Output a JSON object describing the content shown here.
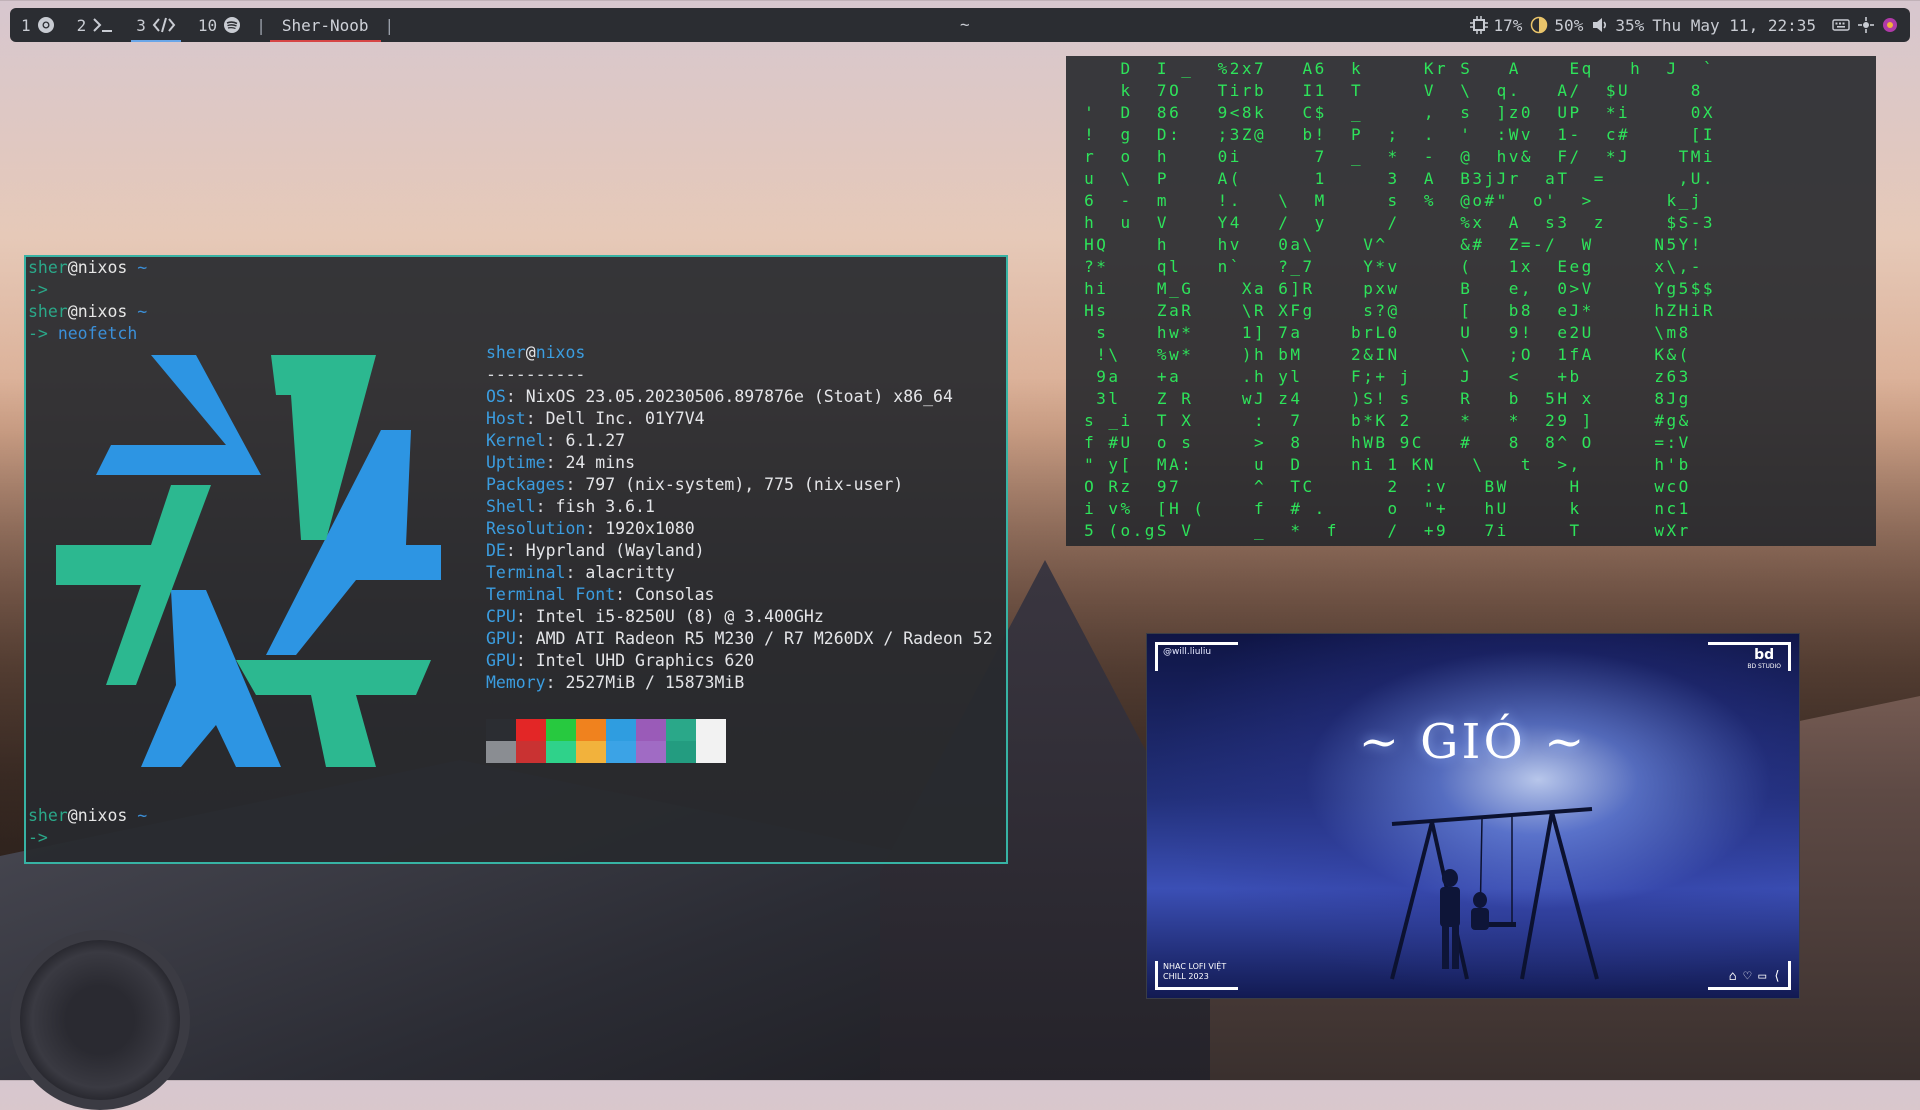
{
  "topbar": {
    "workspaces": [
      {
        "num": "1",
        "icon": "chromium-icon"
      },
      {
        "num": "2",
        "icon": "terminal-icon"
      },
      {
        "num": "3",
        "icon": "code-icon"
      },
      {
        "num": "10",
        "icon": "spotify-icon"
      }
    ],
    "window_title": "Sher-Noob",
    "center": "~",
    "cpu": "17%",
    "brightness": "50%",
    "volume": "35%",
    "datetime": "Thu May 11, 22:35"
  },
  "terminal": {
    "user": "sher",
    "at": "@",
    "host": "nixos",
    "tilde": "~",
    "arrow": "->",
    "command": "neofetch",
    "separator": "----------",
    "info": [
      {
        "k": "OS",
        "v": "NixOS 23.05.20230506.897876e (Stoat) x86_64"
      },
      {
        "k": "Host",
        "v": "Dell Inc. 01Y7V4"
      },
      {
        "k": "Kernel",
        "v": "6.1.27"
      },
      {
        "k": "Uptime",
        "v": "24 mins"
      },
      {
        "k": "Packages",
        "v": "797 (nix-system), 775 (nix-user)"
      },
      {
        "k": "Shell",
        "v": "fish 3.6.1"
      },
      {
        "k": "Resolution",
        "v": "1920x1080"
      },
      {
        "k": "DE",
        "v": "Hyprland (Wayland)"
      },
      {
        "k": "Terminal",
        "v": "alacritty"
      },
      {
        "k": "Terminal Font",
        "v": "Consolas"
      },
      {
        "k": "CPU",
        "v": "Intel i5-8250U (8) @ 3.400GHz"
      },
      {
        "k": "GPU",
        "v": "AMD ATI Radeon R5 M230 / R7 M260DX / Radeon 52"
      },
      {
        "k": "GPU",
        "v": "Intel UHD Graphics 620"
      },
      {
        "k": "Memory",
        "v": "2527MiB / 15873MiB"
      }
    ],
    "palette_top": [
      "#2b2d32",
      "#e32626",
      "#27c93f",
      "#f0821e",
      "#2f9de0",
      "#9a5bb8",
      "#2aa889",
      "#f2f2f2"
    ],
    "palette_bottom": [
      "#8a8d92",
      "#c93232",
      "#2fd28a",
      "#f2b23c",
      "#3ba3e6",
      "#a06bc4",
      "#239c80",
      "#f2f2f2"
    ],
    "logo_colors": {
      "blue": "#2d95e3",
      "teal": "#2cb890"
    }
  },
  "matrix": {
    "rows": [
      "    D  I _  %2x7   A6  k     Kr S   A    Eq   h  J  `   ",
      "    k  7O   Tirb   I1  T     V  \\  q.   A/  $U     8   ",
      " '  D  86   9<8k   C$  _     ,  s  ]z0  UP  *i     0X  ",
      " !  g  D:   ;3Z@   b!  P  ;  .  '  :Wv  1-  c#     [I  ",
      " r  o  h    0i      7  _  *  -  @  hv&  F/  *J    TMi  ",
      " u  \\  P    A(      1     3  A  B3jJr  aT  =      ,U.  ",
      " 6  -  m    !.   \\  M     s  %  @o#\"  o'  >      k_j  ",
      " h  u  V    Y4   /  y     /     %x  A  s3  z     $S-3  ",
      " HQ    h    hv   0a\\    V^      &#  Z=-/  W     N5Y!  ",
      " ?*    ql   n`   ?_7    Y*v     (   1x  Eeg     x\\,-  ",
      " hi    M_G    Xa 6]R    pxw     B   e,  0>V     Yg5$$  ",
      " Hs    ZaR    \\R XFg    s?@     [   b8  eJ*     hZHiR  ",
      "  s    hw*    1] 7a    brL0     U   9!  e2U     \\m8    ",
      "  !\\   %w*    )h bM    2&IN     \\   ;O  1fA     K&(    ",
      "  9a   +a     .h yl    F;+ j    J   <   +b      z63    ",
      "  3l   Z R    wJ z4    )S! s    R   b  5H x     8Jg    ",
      " s _i  T X     :  7    b*K 2    *   *  29 ]     #g&    ",
      " f #U  o s     >  8    hWB 9C   #   8  8^ O     =:V    ",
      " \" y[  MA:     u  D    ni 1 KN   \\   t  >,      h'b    ",
      " O Rz  97      ^  TC      2  :v   BW     H      wcO    ",
      " i v%  [H (    f  # .     o  \"+   hU     k      nc1    ",
      " 5 (o.gS V     _  *  f    /  +9   7i     T      wXr    "
    ]
  },
  "video": {
    "channel": "@will.liuliu",
    "logo_text": "bd",
    "logo_sub": "BD STUDIO",
    "title": "~ GIÓ ~",
    "footer_line1": "NHAC LOFI VIỆT",
    "footer_line2": "CHILL 2023"
  }
}
